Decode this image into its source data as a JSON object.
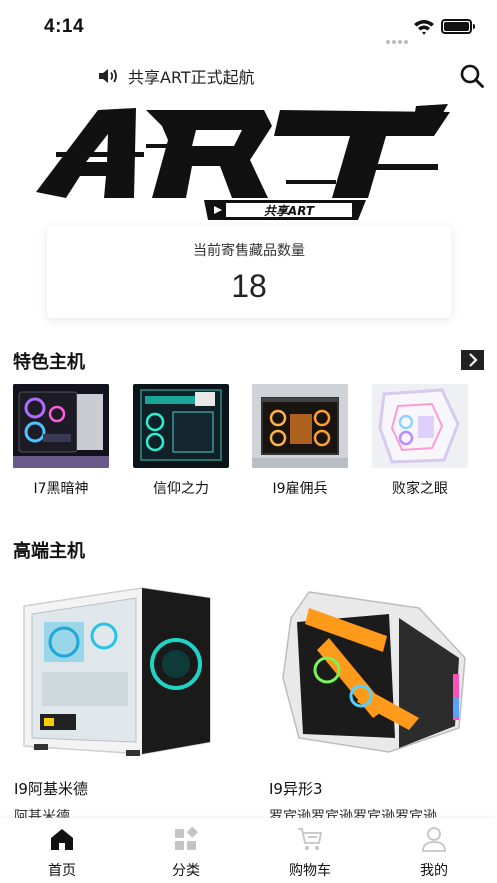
{
  "status_bar": {
    "time": "4:14"
  },
  "notice": {
    "text": "共享ART正式起航"
  },
  "logo": {
    "main": "ART",
    "sub": "共享ART"
  },
  "stats": {
    "label": "当前寄售藏品数量",
    "value": "18"
  },
  "featured": {
    "title": "特色主机",
    "items": [
      {
        "label": "I7黑暗神"
      },
      {
        "label": "信仰之力"
      },
      {
        "label": "I9雇佣兵"
      },
      {
        "label": "败家之眼"
      }
    ]
  },
  "high_end": {
    "title": "高端主机",
    "items": [
      {
        "name": "I9阿基米德",
        "desc": "阿基米德"
      },
      {
        "name": "I9异形3",
        "desc": "罗宾逊罗宾逊罗宾逊罗宾逊"
      }
    ]
  },
  "tab_bar": {
    "tabs": [
      {
        "label": "首页",
        "icon": "home-icon"
      },
      {
        "label": "分类",
        "icon": "category-icon"
      },
      {
        "label": "购物车",
        "icon": "cart-icon"
      },
      {
        "label": "我的",
        "icon": "profile-icon"
      }
    ]
  },
  "colors": {
    "accent": "#111111",
    "tab_inactive": "#bfbfbf",
    "background": "#ffffff"
  }
}
